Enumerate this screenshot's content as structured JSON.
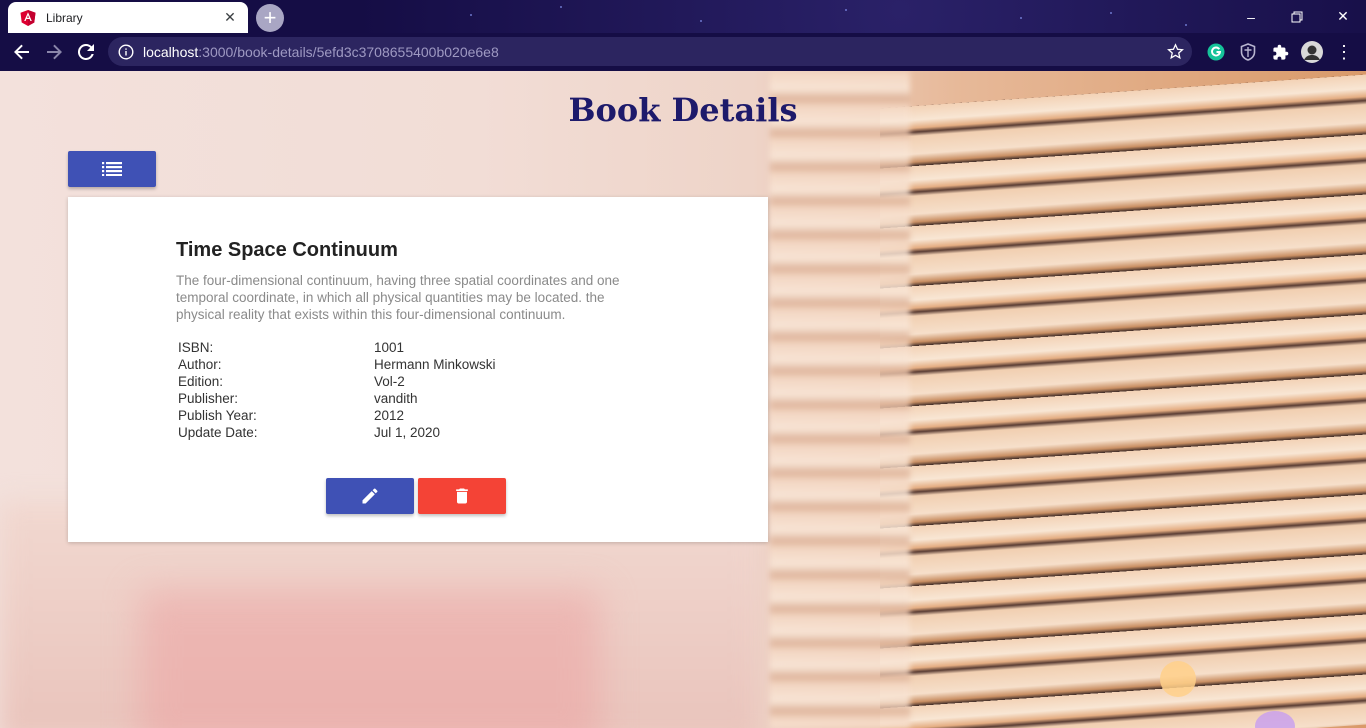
{
  "browser": {
    "tab_title": "Library",
    "url_host": "localhost",
    "url_path": ":3000/book-details/5efd3c3708655400b020e6e8"
  },
  "page": {
    "title": "Book Details"
  },
  "book": {
    "title": "Time Space Continuum",
    "description": "The four-dimensional continuum, having three spatial coordinates and one temporal coordinate, in which all physical quantities may be located. the physical reality that exists within this four-dimensional continuum.",
    "details": [
      {
        "label": "ISBN:",
        "value": "1001"
      },
      {
        "label": "Author:",
        "value": "Hermann Minkowski"
      },
      {
        "label": "Edition:",
        "value": "Vol-2"
      },
      {
        "label": "Publisher:",
        "value": "vandith"
      },
      {
        "label": "Publish Year:",
        "value": "2012"
      },
      {
        "label": "Update Date:",
        "value": "Jul 1, 2020"
      }
    ]
  },
  "colors": {
    "primary": "#3f51b5",
    "danger": "#f44336",
    "title": "#1d1a6b"
  },
  "icons": {
    "list_button": "list-icon",
    "edit_button": "pencil-icon",
    "delete_button": "trash-icon"
  }
}
